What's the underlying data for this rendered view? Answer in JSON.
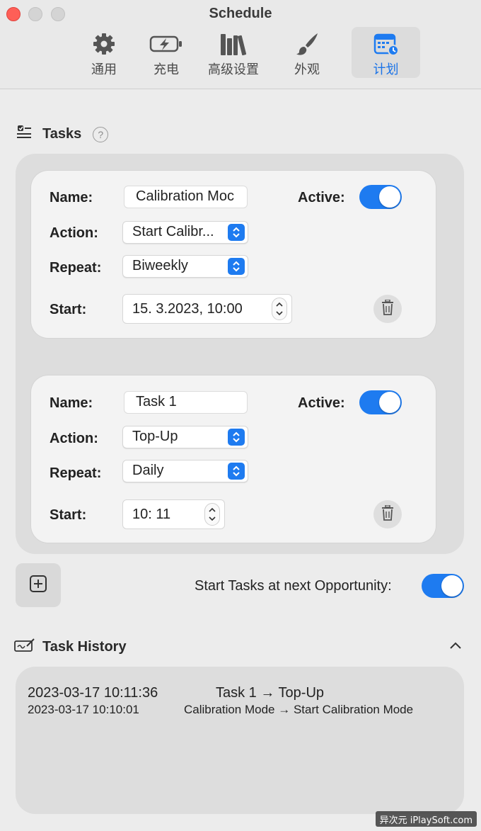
{
  "window": {
    "title": "Schedule"
  },
  "toolbar": {
    "items": [
      {
        "label": "通用",
        "icon": "gear-icon"
      },
      {
        "label": "充电",
        "icon": "battery-charging-icon"
      },
      {
        "label": "高级设置",
        "icon": "books-icon"
      },
      {
        "label": "外观",
        "icon": "paintbrush-icon"
      },
      {
        "label": "计划",
        "icon": "calendar-clock-icon",
        "active": true
      }
    ]
  },
  "tasks": {
    "title": "Tasks",
    "help": "?",
    "labels": {
      "name": "Name:",
      "action": "Action:",
      "repeat": "Repeat:",
      "start": "Start:",
      "active": "Active:"
    },
    "items": [
      {
        "name": "Calibration Moc",
        "action": "Start Calibr...",
        "repeat": "Biweekly",
        "start": "15.  3.2023,  10:00",
        "active": true
      },
      {
        "name": "Task 1",
        "action": "Top-Up",
        "repeat": "Daily",
        "start": "10:  11",
        "active": true
      }
    ]
  },
  "opportunity": {
    "label": "Start Tasks at next Opportunity:",
    "enabled": true
  },
  "history": {
    "title": "Task History",
    "entries": [
      {
        "time": "2023-03-17 10:11:36",
        "event": "Task 1 → Top-Up"
      },
      {
        "time": "2023-03-17 10:10:01",
        "event": "Calibration Mode → Start Calibration Mode"
      }
    ]
  },
  "watermark": "异次元 iPlaySoft.com",
  "colors": {
    "accent": "#1e7bf0",
    "background": "#ececec",
    "panel": "#dddddd",
    "card": "#f3f3f3"
  }
}
